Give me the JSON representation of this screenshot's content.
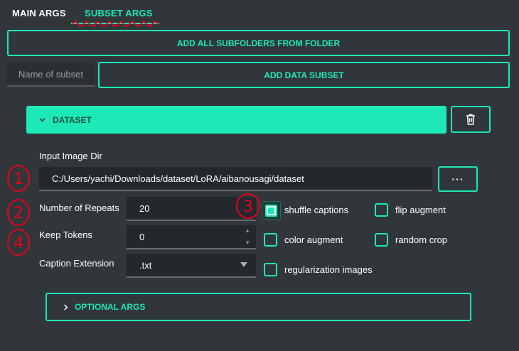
{
  "tabs": {
    "main": "MAIN ARGS",
    "subset": "SUBSET ARGS"
  },
  "buttons": {
    "add_all": "ADD ALL SUBFOLDERS FROM FOLDER",
    "add_subset": "ADD DATA SUBSET",
    "browse": "···"
  },
  "subset_name": {
    "placeholder": "Name of subset"
  },
  "dataset": {
    "title": "DATASET",
    "input_dir_label": "Input Image Dir",
    "input_dir_value": "C:/Users/yachi/Downloads/dataset/LoRA/aibanousagi/dataset",
    "repeats_label": "Number of Repeats",
    "repeats_value": "20",
    "keep_tokens_label": "Keep Tokens",
    "keep_tokens_value": "0",
    "caption_ext_label": "Caption Extension",
    "caption_ext_value": ".txt",
    "checkboxes": {
      "shuffle_captions": {
        "label": "shuffle captions",
        "checked": true
      },
      "flip_augment": {
        "label": "flip augment",
        "checked": false
      },
      "color_augment": {
        "label": "color augment",
        "checked": false
      },
      "random_crop": {
        "label": "random crop",
        "checked": false
      },
      "regularization_images": {
        "label": "regularization images",
        "checked": false
      }
    }
  },
  "optional": {
    "title": "OPTIONAL ARGS"
  },
  "annotations": [
    "1",
    "2",
    "3",
    "4"
  ],
  "colors": {
    "accent": "#1de9b6",
    "background": "#31363b",
    "annotation": "#e8001c"
  }
}
